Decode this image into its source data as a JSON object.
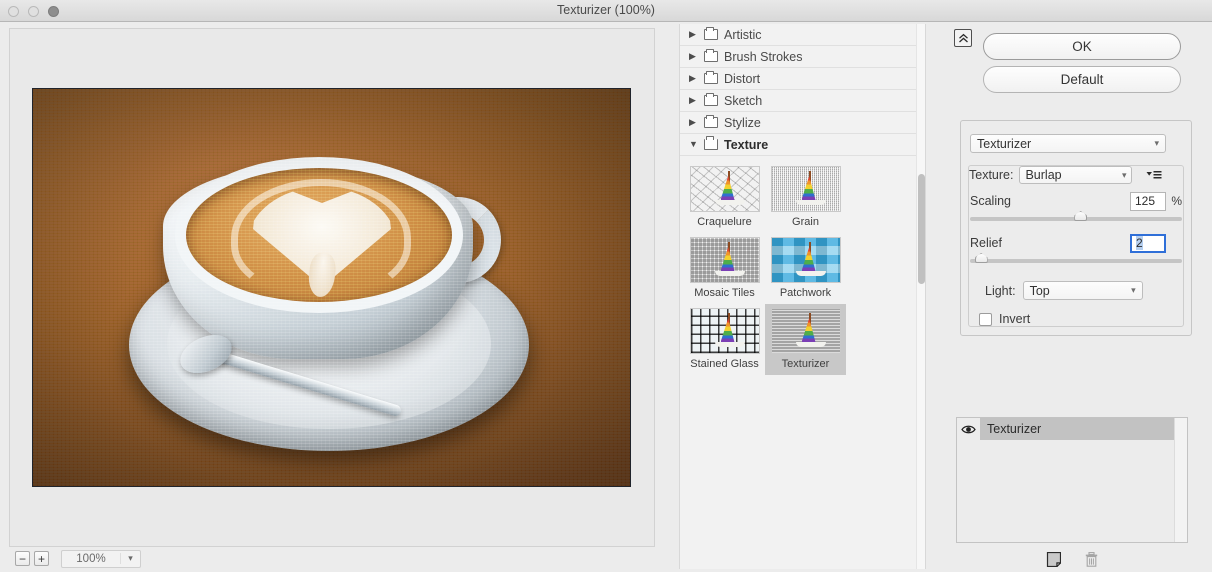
{
  "window": {
    "title": "Texturizer (100%)",
    "traffic_lights": [
      "close",
      "minimize",
      "zoom"
    ]
  },
  "preview": {
    "zoom_minus_label": "−",
    "zoom_plus_label": "+",
    "zoom_level": "100%",
    "image_description": "latte-art-coffee-cup-on-burlap-textured-surface"
  },
  "filter_browser": {
    "categories": [
      {
        "label": "Artistic",
        "expanded": false
      },
      {
        "label": "Brush Strokes",
        "expanded": false
      },
      {
        "label": "Distort",
        "expanded": false
      },
      {
        "label": "Sketch",
        "expanded": false
      },
      {
        "label": "Stylize",
        "expanded": false
      },
      {
        "label": "Texture",
        "expanded": true
      }
    ],
    "thumbnails": [
      {
        "label": "Craquelure",
        "selected": false,
        "tex": "tex-craq"
      },
      {
        "label": "Grain",
        "selected": false,
        "tex": "tex-grain"
      },
      {
        "label": "Mosaic Tiles",
        "selected": false,
        "tex": "tex-mosaic"
      },
      {
        "label": "Patchwork",
        "selected": false,
        "tex": "tex-patch"
      },
      {
        "label": "Stained Glass",
        "selected": false,
        "tex": "tex-stained"
      },
      {
        "label": "Texturizer",
        "selected": true,
        "tex": "tex-texturizer"
      }
    ]
  },
  "settings": {
    "collapse_label": "»",
    "ok_label": "OK",
    "default_label": "Default",
    "filter_name": "Texturizer",
    "texture_row_label": "Texture:",
    "texture_value": "Burlap",
    "scaling": {
      "label": "Scaling",
      "value": "125",
      "unit": "%",
      "position_percent": 52
    },
    "relief": {
      "label": "Relief",
      "value": "2",
      "unit": "",
      "position_percent": 5,
      "focused": true
    },
    "light_label": "Light:",
    "light_value": "Top",
    "invert_label": "Invert",
    "invert_checked": false,
    "accent_color": "#2f6fd8",
    "selection_color": "#b5cff0"
  },
  "layers": {
    "items": [
      {
        "name": "Texturizer",
        "visible": true,
        "selected": true
      }
    ],
    "new_layer_title": "New effect layer",
    "delete_title": "Delete effect layer"
  }
}
